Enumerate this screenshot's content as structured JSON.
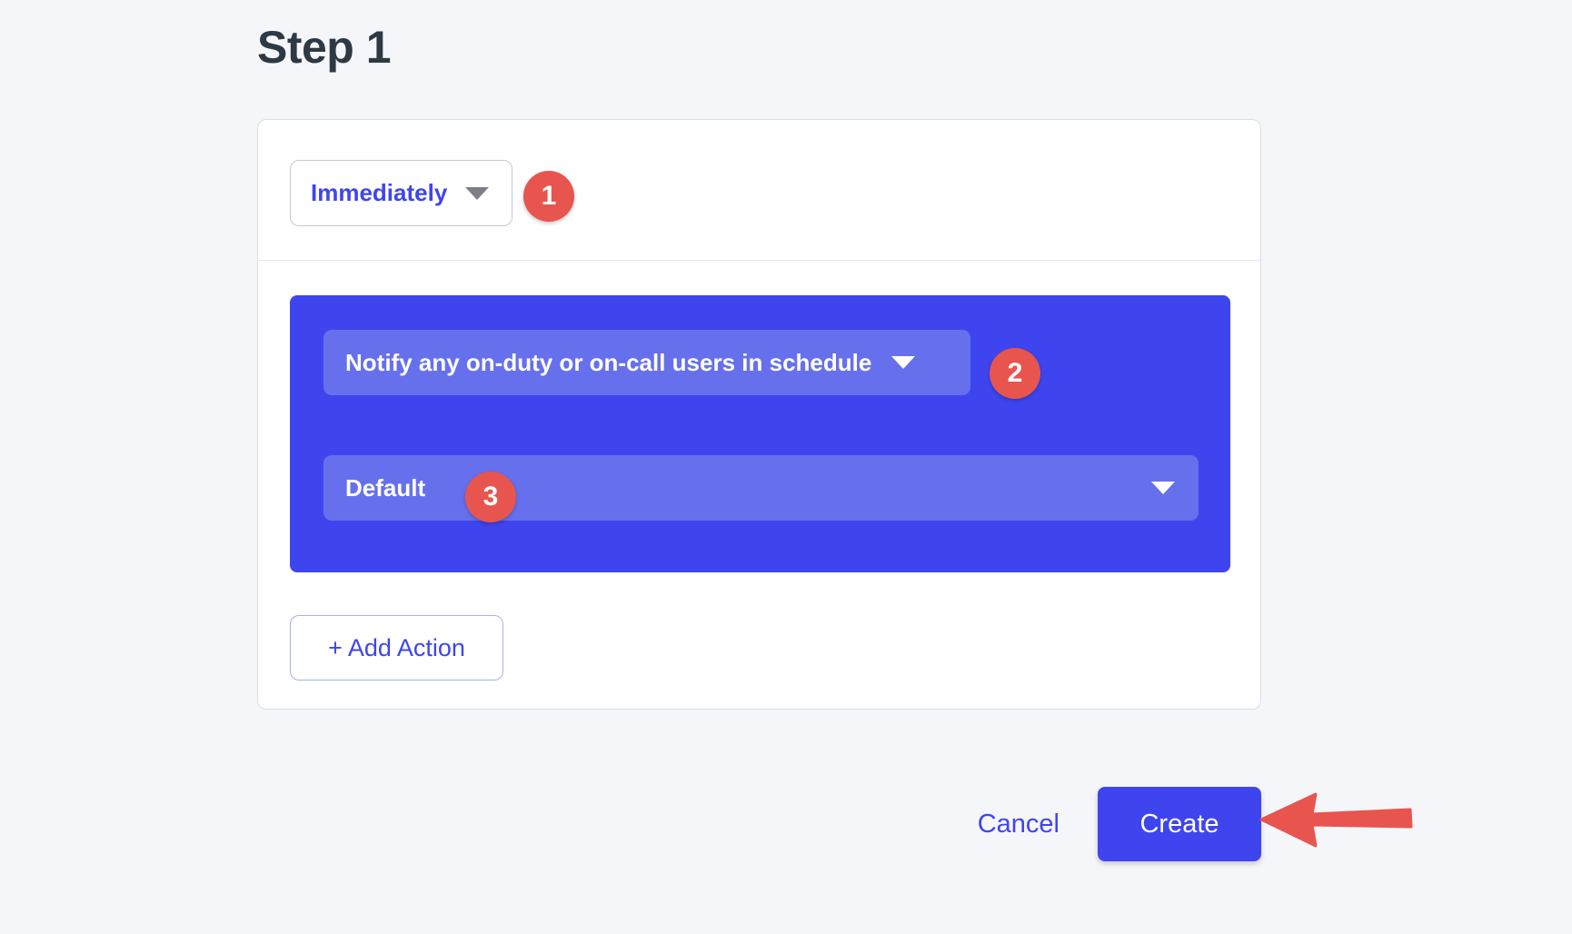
{
  "page": {
    "title": "Step 1",
    "background_color": "#f5f6fa"
  },
  "colors": {
    "accent_indigo": "#3f45ee",
    "accent_indigo_light": "#6670ed",
    "badge_red": "#e8554e",
    "title_text": "#2f3943",
    "card_border": "#dcdee3"
  },
  "card": {
    "when_select": {
      "value": "Immediately",
      "caret_icon": "chevron-down-icon"
    },
    "action_block": {
      "action_type_select": {
        "value": "Notify any on-duty or on-call users in schedule",
        "caret_icon": "chevron-down-icon"
      },
      "schedule_select": {
        "value": "Default",
        "caret_icon": "chevron-down-icon"
      }
    },
    "add_action_label": "+ Add Action"
  },
  "badges": [
    {
      "number": "1"
    },
    {
      "number": "2"
    },
    {
      "number": "3"
    }
  ],
  "footer": {
    "cancel_label": "Cancel",
    "create_label": "Create"
  },
  "annotations": {
    "arrow_icon": "left-arrow-icon",
    "arrow_color": "#e8554e"
  }
}
